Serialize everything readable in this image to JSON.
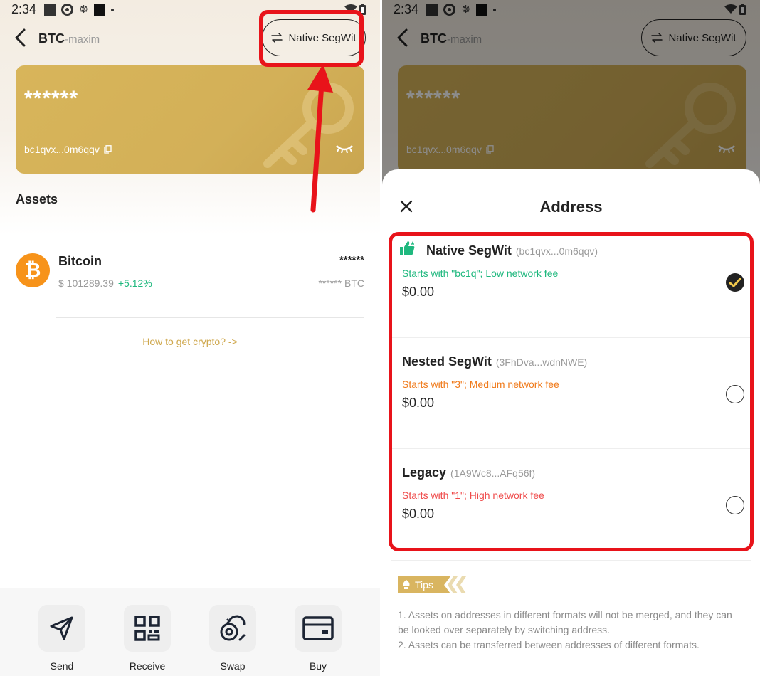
{
  "status": {
    "time": "2:34"
  },
  "left": {
    "header": {
      "title": "BTC",
      "subtitle": "-maxim",
      "address_type_button": "Native SegWit"
    },
    "card": {
      "masked_balance": "******",
      "address": "bc1qvx...0m6qqv"
    },
    "assets_title": "Assets",
    "asset": {
      "name": "Bitcoin",
      "price": "$ 101289.39",
      "change": "+5.12%",
      "balance": "******",
      "balance_unit": "****** BTC"
    },
    "how_to_link": "How to get crypto? ->",
    "actions": [
      {
        "label": "Send",
        "icon": "send-icon"
      },
      {
        "label": "Receive",
        "icon": "qr-code-icon"
      },
      {
        "label": "Swap",
        "icon": "swap-icon"
      },
      {
        "label": "Buy",
        "icon": "card-icon"
      }
    ]
  },
  "right": {
    "header": {
      "title": "BTC",
      "subtitle": "-maxim",
      "address_type_button": "Native SegWit"
    },
    "card": {
      "masked_balance": "******",
      "address": "bc1qvx...0m6qqv"
    },
    "sheet": {
      "title": "Address",
      "options": [
        {
          "name": "Native SegWit",
          "short_address": "(bc1qvx...0m6qqv)",
          "description": "Starts with \"bc1q\"; Low network fee",
          "description_color": "#1fb87e",
          "amount": "$0.00",
          "selected": true,
          "icon": "thumbs-up-icon"
        },
        {
          "name": "Nested SegWit",
          "short_address": "(3FhDva...wdnNWE)",
          "description": "Starts with \"3\"; Medium network fee",
          "description_color": "#f07a1a",
          "amount": "$0.00",
          "selected": false
        },
        {
          "name": "Legacy",
          "short_address": "(1A9Wc8...AFq56f)",
          "description": "Starts with \"1\"; High network fee",
          "description_color": "#ef4b4b",
          "amount": "$0.00",
          "selected": false
        }
      ],
      "tips_label": "Tips",
      "tips": [
        "1. Assets on addresses in different formats will not be merged, and they can be looked over separately by switching address.",
        "2. Assets can be transferred between addresses of different formats."
      ]
    }
  },
  "colors": {
    "accent_gold": "#d8b55a",
    "annotation_red": "#e8131a",
    "bitcoin_orange": "#f7931a",
    "positive_green": "#1fb87e"
  }
}
